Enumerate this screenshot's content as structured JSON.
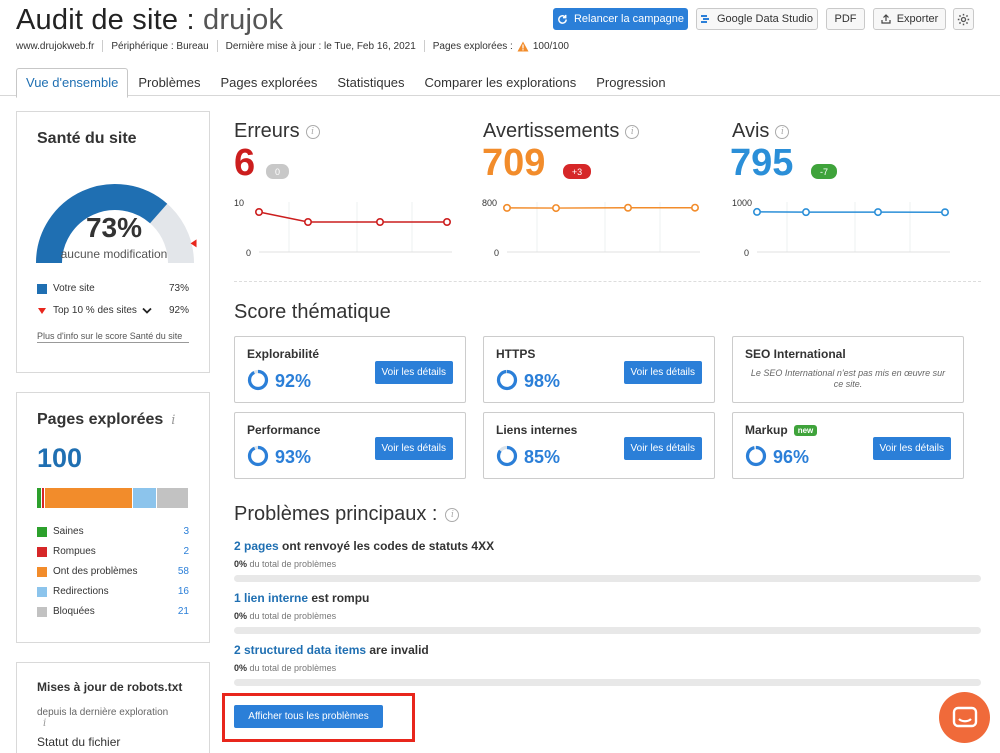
{
  "header": {
    "title_prefix": "Audit de site : ",
    "project": "drujok",
    "buttons": {
      "relaunch": "Relancer la campagne",
      "gds": "Google Data Studio",
      "pdf": "PDF",
      "export": "Exporter"
    }
  },
  "meta": {
    "domain": "www.drujokweb.fr",
    "device": "Périphérique : Bureau",
    "updated": "Dernière mise à jour : le Tue, Feb 16, 2021",
    "pages_label": "Pages explorées :",
    "pages_value": "100/100"
  },
  "tabs": [
    "Vue d'ensemble",
    "Problèmes",
    "Pages explorées",
    "Statistiques",
    "Comparer les explorations",
    "Progression"
  ],
  "health": {
    "title": "Santé du site",
    "score": "73%",
    "score_value": 0.73,
    "top10_value": 0.92,
    "status": "aucune modification",
    "legend": [
      {
        "label": "Votre site",
        "value": "73%"
      },
      {
        "label": "Top 10 % des sites",
        "value": "92%"
      }
    ],
    "more_info": "Plus d'info sur le score Santé du site",
    "colors": {
      "site": "#1f6fb2",
      "track": "#e3e6ea",
      "marker": "#e8261c"
    }
  },
  "crawled": {
    "title": "Pages explorées",
    "total": "100",
    "segments": [
      {
        "label": "Saines",
        "value": "3",
        "color": "#2ca02c"
      },
      {
        "label": "Rompues",
        "value": "2",
        "color": "#d62728"
      },
      {
        "label": "Ont des problèmes",
        "value": "58",
        "color": "#f28c2b"
      },
      {
        "label": "Redirections",
        "value": "16",
        "color": "#8cc4ec"
      },
      {
        "label": "Bloquées",
        "value": "21",
        "color": "#c2c2c2"
      }
    ]
  },
  "robots": {
    "title": "Mises à jour de robots.txt",
    "subtitle": "depuis la dernière exploration",
    "status_label": "Statut du fichier"
  },
  "metrics": [
    {
      "name": "Erreurs",
      "value": "6",
      "delta": "0",
      "color": "#cc1e1e",
      "delta_color": "#c8c8c8",
      "y_top": "10",
      "y_bottom": "0",
      "series": [
        8,
        6,
        6,
        6
      ],
      "ymax": 10
    },
    {
      "name": "Avertissements",
      "value": "709",
      "delta": "+3",
      "color": "#f28c2b",
      "delta_color": "#d62728",
      "y_top": "800",
      "y_bottom": "0",
      "series": [
        706,
        703,
        708,
        709
      ],
      "ymax": 800
    },
    {
      "name": "Avis",
      "value": "795",
      "delta": "-7",
      "color": "#2b8fd8",
      "delta_color": "#3fa33b",
      "y_top": "1000",
      "y_bottom": "0",
      "series": [
        802,
        797,
        798,
        795
      ],
      "ymax": 1000
    }
  ],
  "thematic": {
    "title": "Score thématique",
    "details_label": "Voir les détails",
    "cards": [
      {
        "name": "Explorabilité",
        "pct": "92%",
        "value": 0.92
      },
      {
        "name": "HTTPS",
        "pct": "98%",
        "value": 0.98
      },
      {
        "name": "SEO International",
        "note": "Le SEO International n'est pas mis en œuvre sur ce site."
      },
      {
        "name": "Performance",
        "pct": "93%",
        "value": 0.93
      },
      {
        "name": "Liens internes",
        "pct": "85%",
        "value": 0.85
      },
      {
        "name": "Markup",
        "badge": "new",
        "pct": "96%",
        "value": 0.96
      }
    ]
  },
  "issues": {
    "title": "Problèmes principaux :",
    "items": [
      {
        "link": "2 pages",
        "text": " ont renvoyé les codes de statuts 4XX",
        "pct": "0%",
        "sub": " du total de problèmes"
      },
      {
        "link": "1 lien interne",
        "text": " est rompu",
        "pct": "0%",
        "sub": " du total de problèmes"
      },
      {
        "link": "2 structured data items",
        "text": " are invalid",
        "pct": "0%",
        "sub": " du total de problèmes"
      }
    ],
    "show_all": "Afficher tous les problèmes"
  }
}
